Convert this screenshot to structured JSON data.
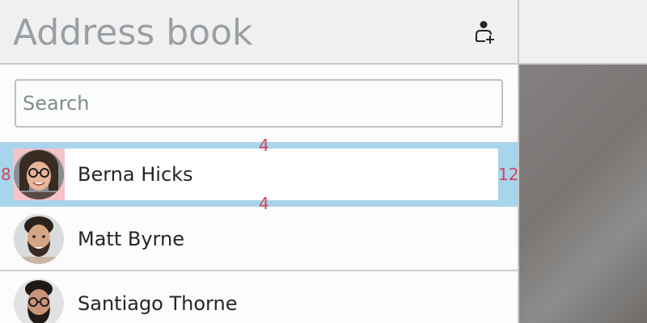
{
  "header": {
    "title": "Address book",
    "add_contact_icon": "add-contact-icon"
  },
  "search": {
    "placeholder": "Search",
    "value": ""
  },
  "contacts": [
    {
      "name": "Berna Hicks",
      "avatar": "woman-with-glasses-photo",
      "highlighted": true
    },
    {
      "name": "Matt Byrne",
      "avatar": "man-with-beard-photo",
      "highlighted": false
    },
    {
      "name": "Santiago Thorne",
      "avatar": "man-with-glasses-photo",
      "highlighted": false
    }
  ],
  "debug_overlay": {
    "top_margin": "4",
    "bottom_margin": "4",
    "left_margin": "8",
    "right_margin": "12"
  },
  "colors": {
    "highlight": "#a8d4ec",
    "avatar_padding": "#f4c2c8",
    "margin_label": "#d0455b",
    "header_bg": "#eff0f1",
    "title_text": "#9c9fa2"
  }
}
